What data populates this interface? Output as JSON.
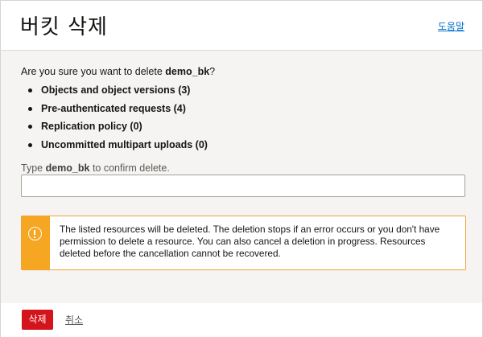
{
  "dialog": {
    "title": "버킷 삭제",
    "help_label": "도움말"
  },
  "body": {
    "question_prefix": "Are you sure you want to delete ",
    "bucket_name": "demo_bk",
    "question_suffix": "?",
    "resources": [
      {
        "label": "Objects and object versions (3)"
      },
      {
        "label": "Pre-authenticated requests (4)"
      },
      {
        "label": "Replication policy (0)"
      },
      {
        "label": "Uncommitted multipart uploads (0)"
      }
    ],
    "confirm_prefix": "Type ",
    "confirm_name": "demo_bk",
    "confirm_suffix": " to confirm delete.",
    "confirm_value": "",
    "warning_text": "The listed resources will be deleted. The deletion stops if an error occurs or you don't have permission to delete a resource. You can also cancel a deletion in progress. Resources deleted before the cancellation cannot be recovered.",
    "warning_icon": "warning-circle-icon",
    "colors": {
      "warning": "#f5a623",
      "danger": "#d3141c",
      "link": "#0572ce"
    }
  },
  "footer": {
    "delete_label": "삭제",
    "cancel_label": "취소"
  }
}
